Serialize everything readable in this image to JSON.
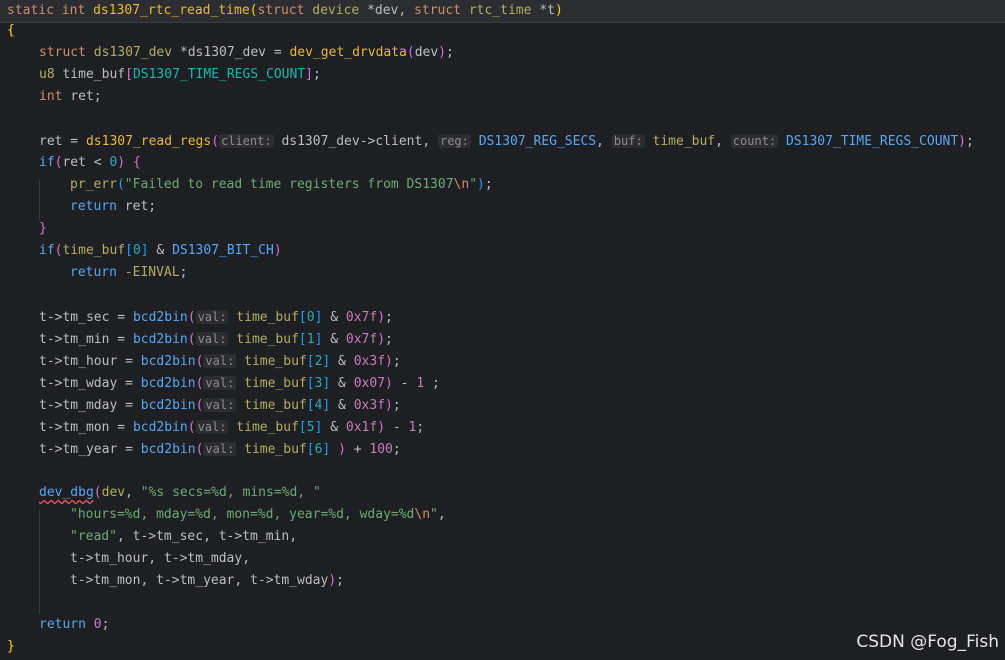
{
  "code": {
    "l0": {
      "kw_static": "static",
      "kw_int": "int",
      "fn": "ds1307_rtc_read_time",
      "kw_struct": "struct",
      "type_device": "device",
      "p_dev": "*dev",
      "kw_struct2": "struct",
      "type_rtc": "rtc_time",
      "p_t": "*t"
    },
    "l1": {
      "brace": "{"
    },
    "l2": {
      "kw_struct": "struct",
      "type": "ds1307_dev",
      "var": "*ds1307_dev",
      "eq": " = ",
      "fn": "dev_get_drvdata",
      "arg": "dev"
    },
    "l3": {
      "type": "u8",
      "var": "time_buf",
      "macro": "DS1307_TIME_REGS_COUNT"
    },
    "l4": {
      "kw": "int",
      "var": "ret"
    },
    "l6": {
      "var": "ret",
      "eq": " = ",
      "fn": "ds1307_read_regs",
      "h1": "client:",
      "a1": "ds1307_dev->client",
      "h2": "reg:",
      "a2": "DS1307_REG_SECS",
      "h3": "buf:",
      "a3": "time_buf",
      "h4": "count:",
      "a4": "DS1307_TIME_REGS_COUNT"
    },
    "l7": {
      "kw": "if",
      "cond_var": "ret",
      "op": " < ",
      "num": "0"
    },
    "l8": {
      "fn": "pr_err",
      "str1": "\"Failed to read time registers from DS1307",
      "esc": "\\n",
      "str2": "\""
    },
    "l9": {
      "kw": "return",
      "var": "ret"
    },
    "l10": {
      "brace": "}"
    },
    "l11": {
      "kw": "if",
      "var": "time_buf",
      "idx": "0",
      "op": " & ",
      "macro": "DS1307_BIT_CH"
    },
    "l12": {
      "kw": "return",
      "val": "-EINVAL"
    },
    "l14": {
      "lhs": "t->tm_sec",
      "fn": "bcd2bin",
      "hint": "val:",
      "var": "time_buf",
      "idx": "0",
      "mask": "0x7f",
      "tail": ""
    },
    "l15": {
      "lhs": "t->tm_min",
      "fn": "bcd2bin",
      "hint": "val:",
      "var": "time_buf",
      "idx": "1",
      "mask": "0x7f",
      "tail": ""
    },
    "l16": {
      "lhs": "t->tm_hour",
      "fn": "bcd2bin",
      "hint": "val:",
      "var": "time_buf",
      "idx": "2",
      "mask": "0x3f",
      "tail": ""
    },
    "l17": {
      "lhs": "t->tm_wday",
      "fn": "bcd2bin",
      "hint": "val:",
      "var": "time_buf",
      "idx": "3",
      "mask": "0x07",
      "tail": " - ",
      "tailnum": "1",
      "tailend": " ;"
    },
    "l18": {
      "lhs": "t->tm_mday",
      "fn": "bcd2bin",
      "hint": "val:",
      "var": "time_buf",
      "idx": "4",
      "mask": "0x3f",
      "tail": ""
    },
    "l19": {
      "lhs": "t->tm_mon",
      "fn": "bcd2bin",
      "hint": "val:",
      "var": "time_buf",
      "idx": "5",
      "mask": "0x1f",
      "tail": " - ",
      "tailnum": "1",
      "tailend": ";"
    },
    "l20": {
      "lhs": "t->tm_year",
      "fn": "bcd2bin",
      "hint": "val:",
      "var": "time_buf",
      "idx": "6",
      "tail": " + ",
      "tailnum": "100",
      "tailend": ";"
    },
    "l22": {
      "fn": "dev_dbg",
      "arg": "dev",
      "str": "\"%s secs=%d, mins=%d, \""
    },
    "l23": {
      "str1": "\"hours=%d, mday=%d, mon=%d, year=%d, wday=%d",
      "esc": "\\n",
      "str2": "\""
    },
    "l24": {
      "str": "\"read\"",
      "a1": "t->tm_sec",
      "a2": "t->tm_min"
    },
    "l25": {
      "a1": "t->tm_hour",
      "a2": "t->tm_mday"
    },
    "l26": {
      "a1": "t->tm_mon",
      "a2": "t->tm_year",
      "a3": "t->tm_wday"
    },
    "l28": {
      "kw": "return",
      "num": "0"
    },
    "l29": {
      "brace": "}"
    }
  },
  "watermark": "CSDN @Fog_Fish",
  "colors": {
    "background": "#1e1f22",
    "keyword": "#cf8e6d",
    "function": "#56a8f5",
    "string": "#6aab73",
    "number": "#2aacb8",
    "macro": "#16baac"
  }
}
